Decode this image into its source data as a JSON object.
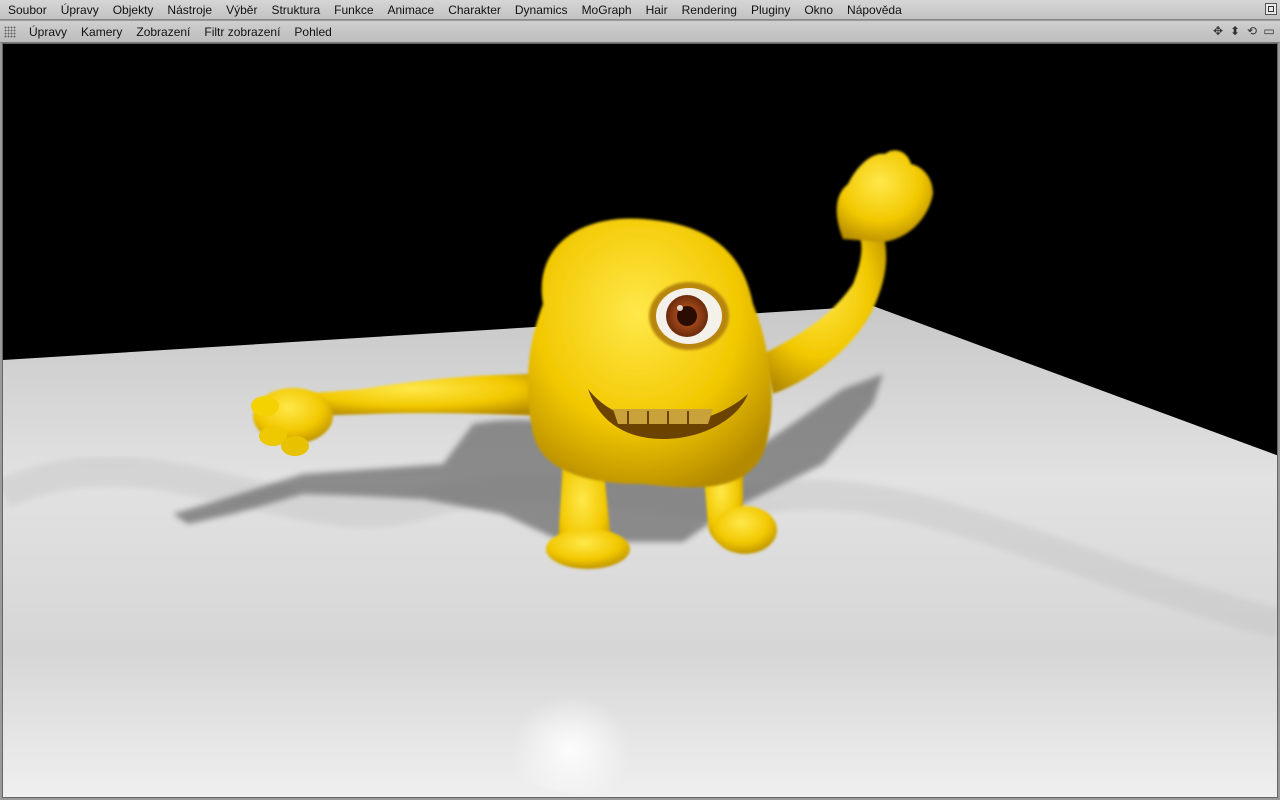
{
  "menubar": {
    "items": [
      "Soubor",
      "Úpravy",
      "Objekty",
      "Nástroje",
      "Výběr",
      "Struktura",
      "Funkce",
      "Animace",
      "Charakter",
      "Dynamics",
      "MoGraph",
      "Hair",
      "Rendering",
      "Pluginy",
      "Okno",
      "Nápověda"
    ]
  },
  "viewbar": {
    "items": [
      "Úpravy",
      "Kamery",
      "Zobrazení",
      "Filtr zobrazení",
      "Pohled"
    ],
    "icons": [
      "move-icon",
      "zoom-icon",
      "rotate-icon",
      "maximize-icon"
    ]
  },
  "viewport": {
    "background": "#000000",
    "floor_color": "#d8d8d8",
    "creature_color": "#f2d100",
    "eye_iris_color": "#8a3a12"
  }
}
